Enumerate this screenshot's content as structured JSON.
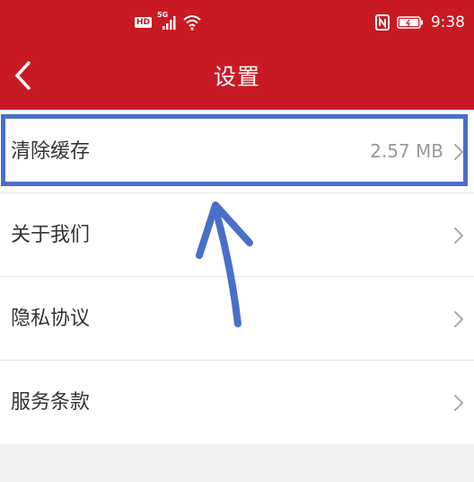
{
  "status_bar": {
    "network_label": "HD",
    "signal_label": "5G",
    "time": "9:38"
  },
  "nav": {
    "title": "设置",
    "back_icon": "chevron-left-icon"
  },
  "settings": {
    "items": [
      {
        "label": "清除缓存",
        "value": "2.57 MB"
      },
      {
        "label": "关于我们"
      },
      {
        "label": "隐私协议"
      },
      {
        "label": "服务条款"
      }
    ]
  },
  "colors": {
    "header_bg": "#c81a22",
    "highlight": "#4a6fc9",
    "page_bg": "#f2f2f2"
  }
}
